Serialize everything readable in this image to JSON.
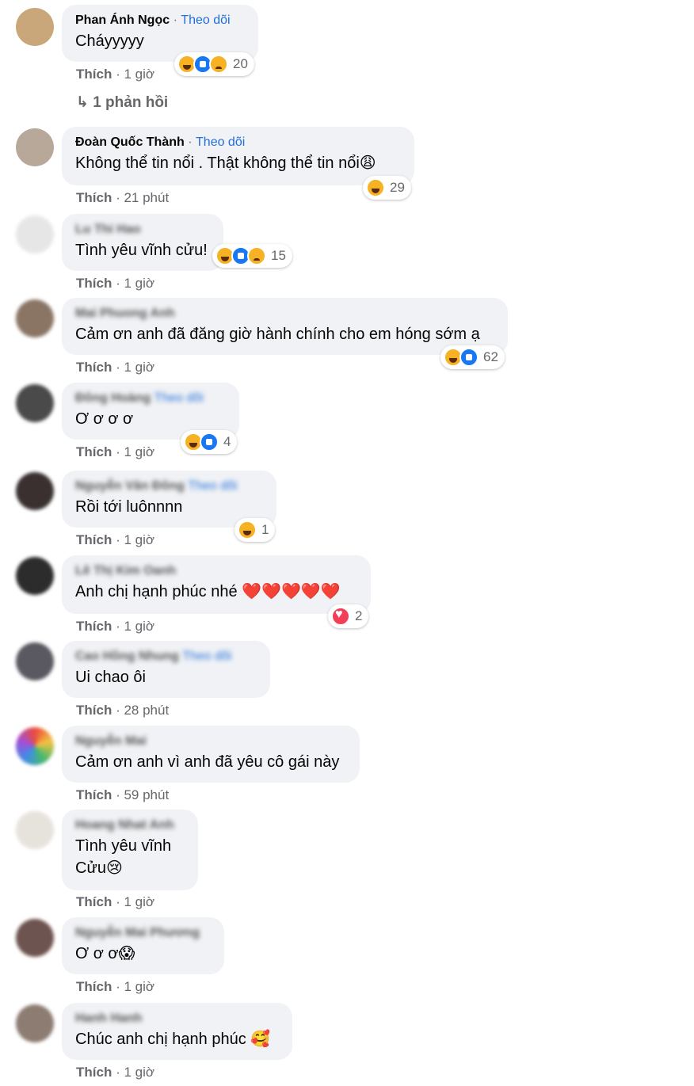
{
  "like_label": "Thích",
  "comments": [
    {
      "name": "Phan Ánh Ngọc",
      "follow": "Theo dõi",
      "text": "Cháyyyyy",
      "time": "1 giờ",
      "reactions": "20"
    },
    {
      "name": "Đoàn Quốc Thành",
      "follow": "Theo dõi",
      "text": "Không thể tin nổi . Thật không thể tin nổi😩",
      "time": "21 phút",
      "reactions": "29"
    },
    {
      "name": "Lu Thi Hao",
      "text": "Tình yêu vĩnh cửu!",
      "time": "1 giờ",
      "reactions": "15"
    },
    {
      "name": "Mai Phuong Anh",
      "text": "Cảm ơn anh đã đăng giờ hành chính cho em hóng sớm ạ",
      "time": "1 giờ",
      "reactions": "62"
    },
    {
      "name": "Đông Hoàng",
      "follow": "Theo dõi",
      "text": "Ơ ơ ơ ơ",
      "time": "1 giờ",
      "reactions": "4"
    },
    {
      "name": "Nguyễn Văn Đông",
      "follow": "Theo dõi",
      "text": "Rồi tới luônnnn",
      "time": "1 giờ",
      "reactions": "1"
    },
    {
      "name": "Lê Thị Kim Oanh",
      "text": "Anh chị hạnh phúc nhé ❤️❤️❤️❤️❤️",
      "time": "1 giờ",
      "reactions": "2"
    },
    {
      "name": "Cao Hồng Nhung",
      "follow": "Theo dõi",
      "text": "Ui chao ôi",
      "time": "28 phút"
    },
    {
      "name": "Nguyễn Mai",
      "text": "Cảm ơn anh vì anh đã yêu cô gái này",
      "time": "59 phút"
    },
    {
      "name": "Hoang Nhat Anh",
      "text": "Tình yêu vĩnh",
      "text2": "Cửu😢",
      "time": "1 giờ"
    },
    {
      "name": "Nguyễn Mai Phương",
      "text": "Ơ ơ ơ😱",
      "time": "1 giờ"
    },
    {
      "name": "Hanh Hanh",
      "text": "Chúc anh chị hạnh phúc 🥰",
      "time": "1 giờ"
    }
  ],
  "reply": "↳ 1 phản hồi"
}
